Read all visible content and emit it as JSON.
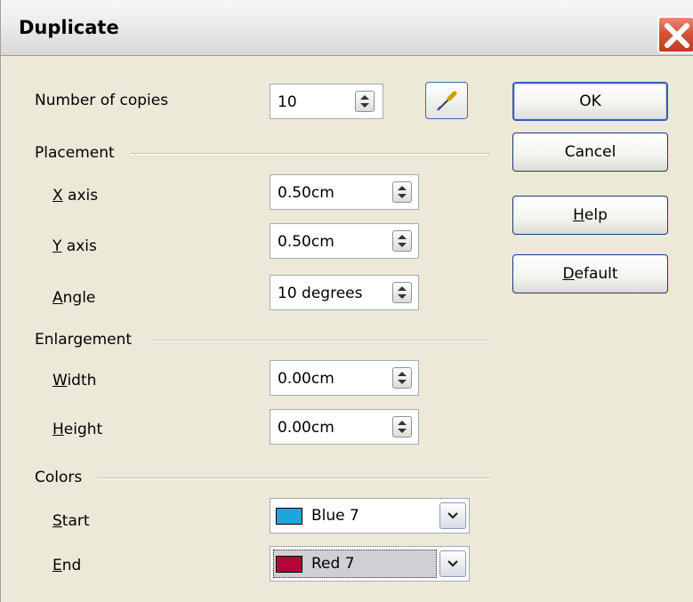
{
  "window": {
    "title": "Duplicate"
  },
  "copies": {
    "label": "Number of copies",
    "value": "10"
  },
  "placement": {
    "heading": "Placement",
    "x_axis": {
      "label": "X axis",
      "value": "0.50cm"
    },
    "y_axis": {
      "label": "Y axis",
      "value": "0.50cm"
    },
    "angle": {
      "label": "Angle",
      "value": "10 degrees"
    }
  },
  "enlargement": {
    "heading": "Enlargement",
    "width": {
      "label": "Width",
      "value": "0.00cm"
    },
    "height": {
      "label": "Height",
      "value": "0.00cm"
    }
  },
  "colors": {
    "heading": "Colors",
    "start": {
      "label": "Start",
      "value": "Blue 7",
      "swatch": "#1aa7e0"
    },
    "end": {
      "label": "End",
      "value": "Red 7",
      "swatch": "#b3053a"
    }
  },
  "buttons": {
    "ok": "OK",
    "cancel": "Cancel",
    "help": "Help",
    "default": "Default"
  },
  "icons": {
    "close": "close-icon",
    "spin": "spin-arrows-icon",
    "picker": "eyedropper-icon",
    "dropdown": "chevron-down-icon"
  }
}
